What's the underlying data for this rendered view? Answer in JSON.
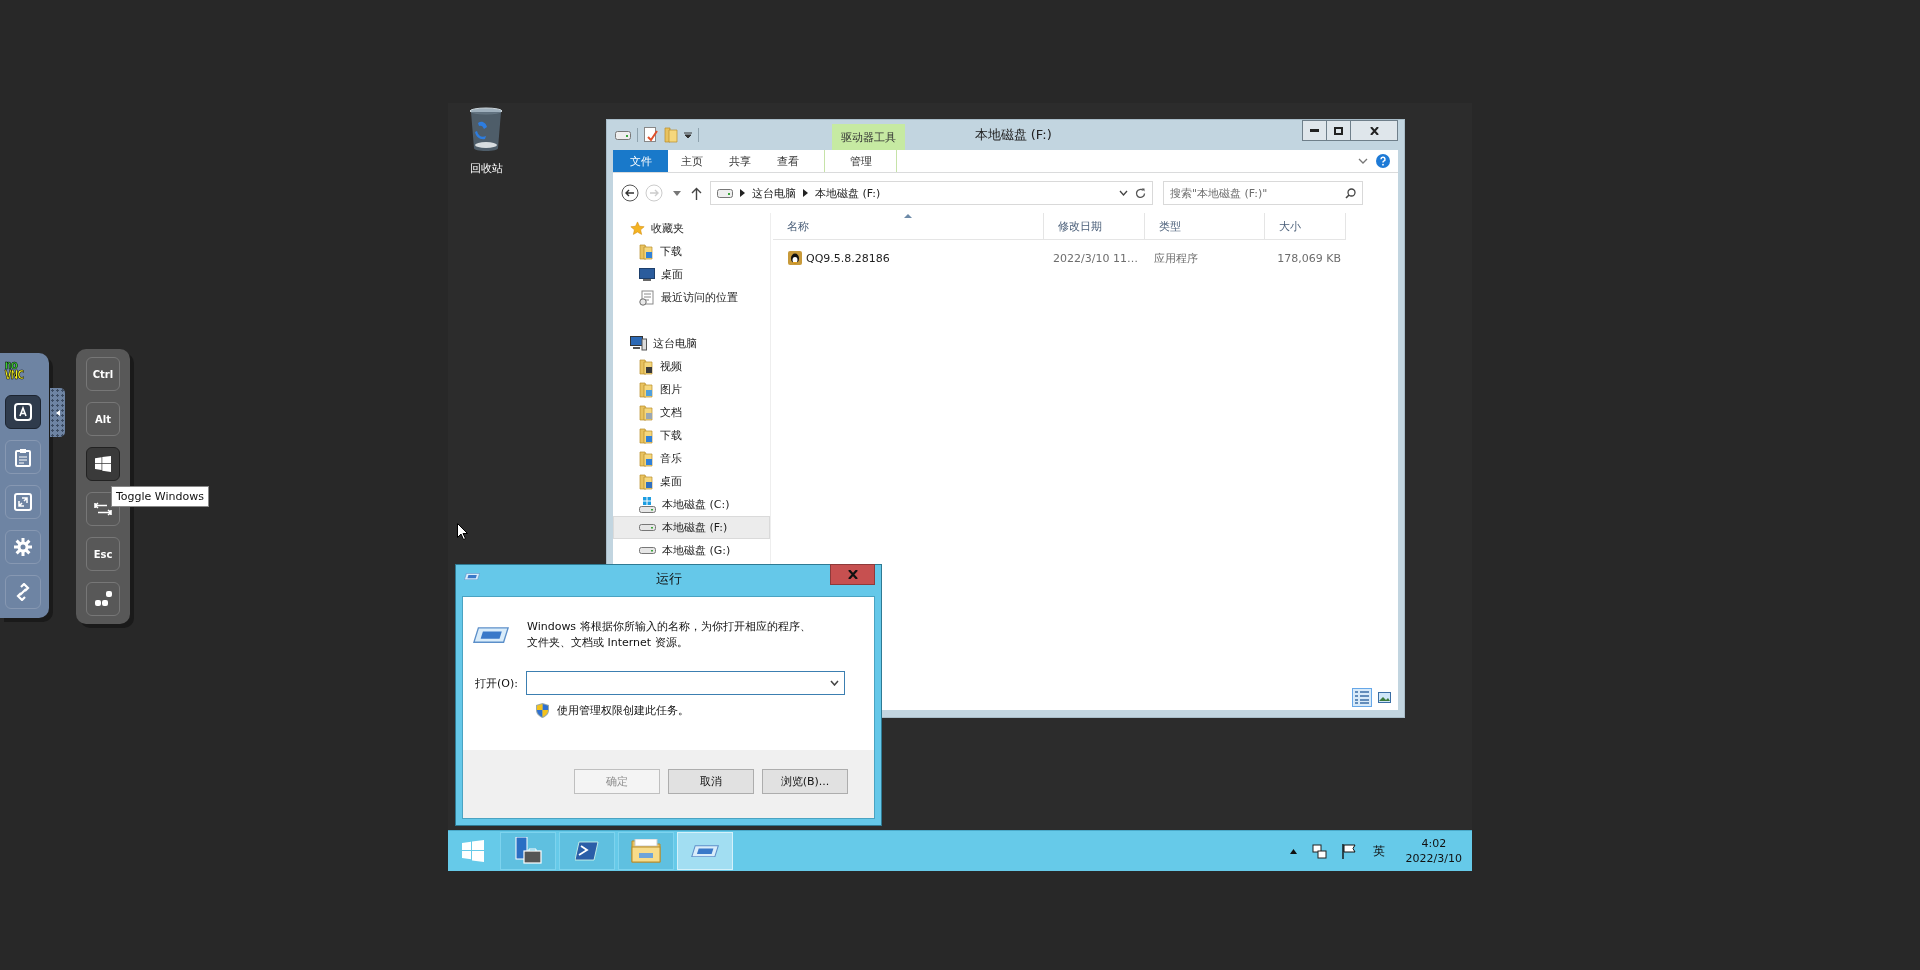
{
  "novnc": {
    "logo": [
      "no",
      "VNC"
    ],
    "side_buttons": [
      {
        "kind": "keyboard",
        "selected": true
      },
      {
        "kind": "clipboard",
        "selected": false
      },
      {
        "kind": "fullscreen",
        "selected": false
      },
      {
        "kind": "settings",
        "selected": false
      },
      {
        "kind": "disconnect",
        "selected": false
      }
    ],
    "extra_keys": [
      {
        "kind": "text",
        "label": "Ctrl",
        "selected": false
      },
      {
        "kind": "text",
        "label": "Alt",
        "selected": false
      },
      {
        "kind": "windows",
        "selected": true
      },
      {
        "kind": "tab",
        "selected": false
      },
      {
        "kind": "text",
        "label": "Esc",
        "selected": false
      },
      {
        "kind": "ctrlaltdel",
        "selected": false
      }
    ],
    "tooltip": "Toggle Windows"
  },
  "desktop": {
    "icons": [
      {
        "label": "回收站"
      }
    ]
  },
  "explorer": {
    "title": "本地磁盘 (F:)",
    "context_group": "驱动器工具",
    "ribbon_tabs": [
      {
        "kind": "file",
        "label": "文件"
      },
      {
        "kind": "tab",
        "label": "主页"
      },
      {
        "kind": "tab",
        "label": "共享"
      },
      {
        "kind": "tab",
        "label": "查看"
      },
      {
        "kind": "context",
        "label": "管理"
      }
    ],
    "address_path": [
      "这台电脑",
      "本地磁盘 (F:)"
    ],
    "search": {
      "placeholder": "搜索\"本地磁盘 (F:)\""
    },
    "navigation": [
      {
        "kind": "favorites",
        "label": "收藏夹",
        "selected": false,
        "children": [
          {
            "kind": "downloads",
            "label": "下载",
            "selected": false
          },
          {
            "kind": "desktop",
            "label": "桌面",
            "selected": false
          },
          {
            "kind": "recent",
            "label": "最近访问的位置",
            "selected": false
          }
        ]
      },
      {
        "kind": "pc",
        "label": "这台电脑",
        "selected": false,
        "children": [
          {
            "kind": "videos",
            "label": "视频",
            "selected": false
          },
          {
            "kind": "pictures",
            "label": "图片",
            "selected": false
          },
          {
            "kind": "documents",
            "label": "文档",
            "selected": false
          },
          {
            "kind": "downloads",
            "label": "下载",
            "selected": false
          },
          {
            "kind": "music",
            "label": "音乐",
            "selected": false
          },
          {
            "kind": "desktop_folder",
            "label": "桌面",
            "selected": false
          },
          {
            "kind": "drive_system",
            "label": "本地磁盘 (C:)",
            "selected": false
          },
          {
            "kind": "drive",
            "label": "本地磁盘 (F:)",
            "selected": true
          },
          {
            "kind": "drive",
            "label": "本地磁盘 (G:)",
            "selected": false
          }
        ]
      }
    ],
    "columns": [
      {
        "label": "名称",
        "sorted": true
      },
      {
        "label": "修改日期",
        "sorted": false
      },
      {
        "label": "类型",
        "sorted": false
      },
      {
        "label": "大小",
        "sorted": false
      }
    ],
    "rows": [
      {
        "name": "QQ9.5.8.28186",
        "modified": "2022/3/10 11…",
        "type": "应用程序",
        "size": "178,069 KB",
        "selected": false
      }
    ],
    "view_buttons": [
      {
        "kind": "details",
        "selected": true
      },
      {
        "kind": "large_icons",
        "selected": false
      }
    ]
  },
  "run_dialog": {
    "title": "运行",
    "description": "Windows 将根据你所输入的名称，为你打开相应的程序、文件夹、文档或 Internet 资源。",
    "open_label": "打开(O):",
    "admin_note": "使用管理权限创建此任务。",
    "buttons": [
      {
        "label": "确定",
        "disabled": true
      },
      {
        "label": "取消",
        "disabled": false
      },
      {
        "label": "浏览(B)...",
        "disabled": false
      }
    ]
  },
  "taskbar": {
    "apps": [
      {
        "kind": "server_manager",
        "selected": false
      },
      {
        "kind": "powershell",
        "selected": false
      },
      {
        "kind": "explorer",
        "selected": false
      },
      {
        "kind": "run",
        "selected": true
      }
    ],
    "ime": "英",
    "time": "4:02",
    "date": "2022/3/10"
  }
}
